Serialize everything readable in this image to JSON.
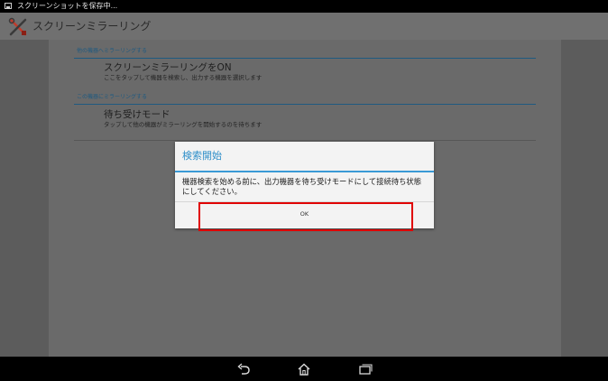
{
  "status_bar": {
    "notification_text": "スクリーンショットを保存中..."
  },
  "action_bar": {
    "title": "スクリーンミラーリング",
    "app_icon": "tools-icon"
  },
  "preferences": {
    "section_mirror_to_other": "他の機器へミラーリングする",
    "mirroring_on": {
      "title": "スクリーンミラーリングをON",
      "summary": "ここをタップして機器を検索し、出力する機器を選択します"
    },
    "section_mirror_to_this": "この機器にミラーリングする",
    "standby_mode": {
      "title": "待ち受けモード",
      "summary": "タップして他の機器がミラーリングを開始するのを待ちます"
    }
  },
  "dialog": {
    "title": "検索開始",
    "message": "機器検索を始める前に、出力機器を待ち受けモードにして接続待ち状態にしてください。",
    "ok_label": "OK"
  },
  "navigation_bar": {
    "back_icon": "back-icon",
    "home_icon": "home-icon",
    "recents_icon": "recent-apps-icon"
  },
  "colors": {
    "accent": "#3a9ad6",
    "section_header": "#1f5a80",
    "highlight": "#e00000"
  }
}
